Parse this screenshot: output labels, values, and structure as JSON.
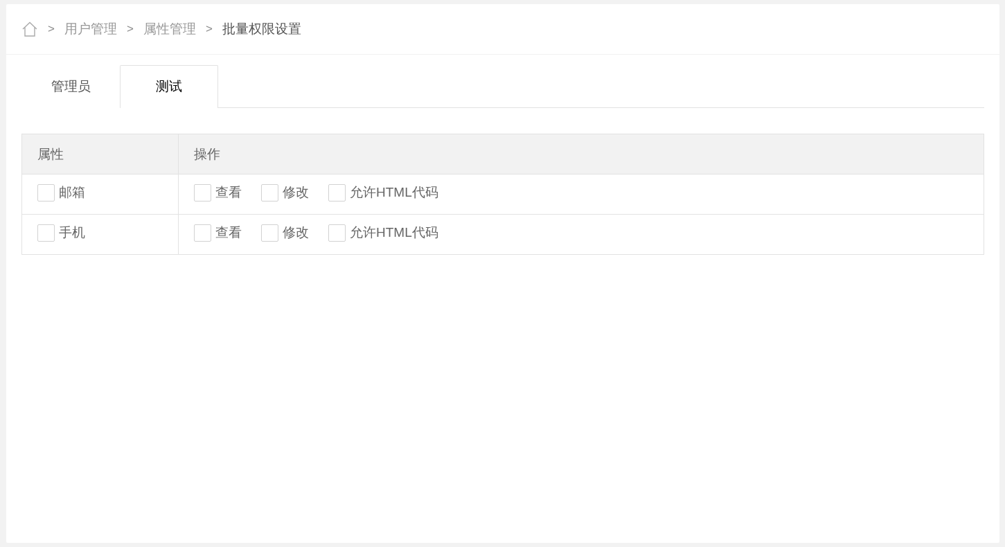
{
  "breadcrumb": [
    {
      "separator": ">",
      "label": "用户管理",
      "current": false
    },
    {
      "separator": ">",
      "label": "属性管理",
      "current": false
    },
    {
      "separator": ">",
      "label": "批量权限设置",
      "current": true
    }
  ],
  "tabs": [
    {
      "label": "管理员",
      "selected": false
    },
    {
      "label": "测试",
      "selected": true
    }
  ],
  "table": {
    "columns": [
      "属性",
      "操作"
    ],
    "rows": [
      {
        "attribute": {
          "label": "邮箱",
          "checked": false
        },
        "operations": [
          {
            "label": "查看",
            "checked": false
          },
          {
            "label": "修改",
            "checked": false
          },
          {
            "label": "允许HTML代码",
            "checked": false
          }
        ]
      },
      {
        "attribute": {
          "label": "手机",
          "checked": false
        },
        "operations": [
          {
            "label": "查看",
            "checked": false
          },
          {
            "label": "修改",
            "checked": false
          },
          {
            "label": "允许HTML代码",
            "checked": false
          }
        ]
      }
    ]
  }
}
